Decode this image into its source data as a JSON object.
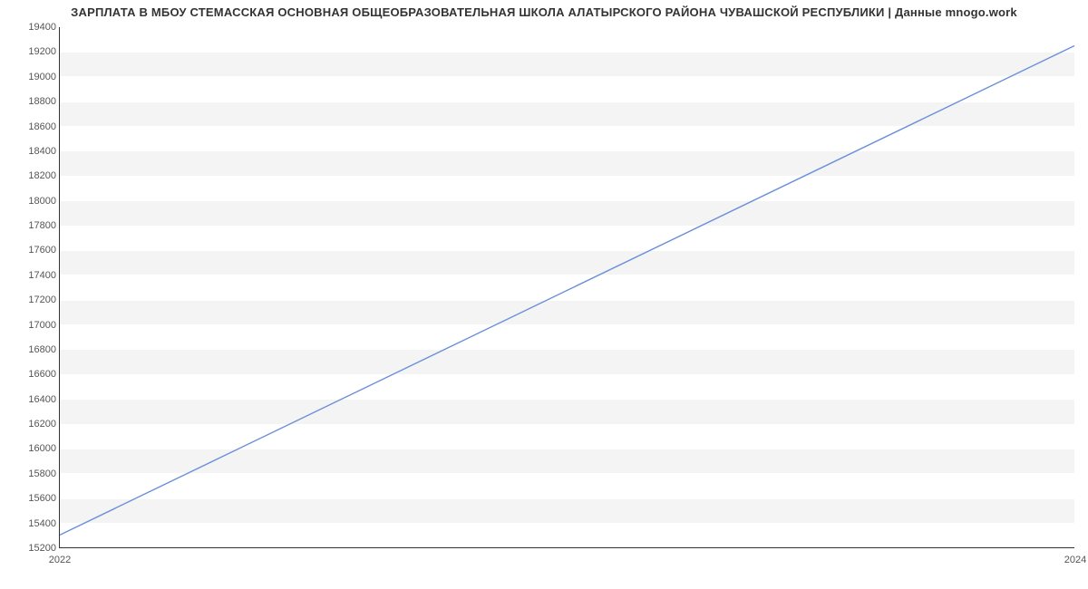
{
  "chart_data": {
    "type": "line",
    "title": "ЗАРПЛАТА В МБОУ СТЕМАССКАЯ ОСНОВНАЯ ОБЩЕОБРАЗОВАТЕЛЬНАЯ ШКОЛА АЛАТЫРСКОГО РАЙОНА ЧУВАШСКОЙ РЕСПУБЛИКИ | Данные mnogo.work",
    "x": [
      2022,
      2024
    ],
    "values": [
      15300,
      19250
    ],
    "x_ticks": [
      2022,
      2024
    ],
    "y_ticks": [
      15200,
      15400,
      15600,
      15800,
      16000,
      16200,
      16400,
      16600,
      16800,
      17000,
      17200,
      17400,
      17600,
      17800,
      18000,
      18200,
      18400,
      18600,
      18800,
      19000,
      19200,
      19400
    ],
    "xlim": [
      2022,
      2024
    ],
    "ylim": [
      15200,
      19400
    ],
    "xlabel": "",
    "ylabel": "",
    "line_color": "#6a8fd8"
  }
}
